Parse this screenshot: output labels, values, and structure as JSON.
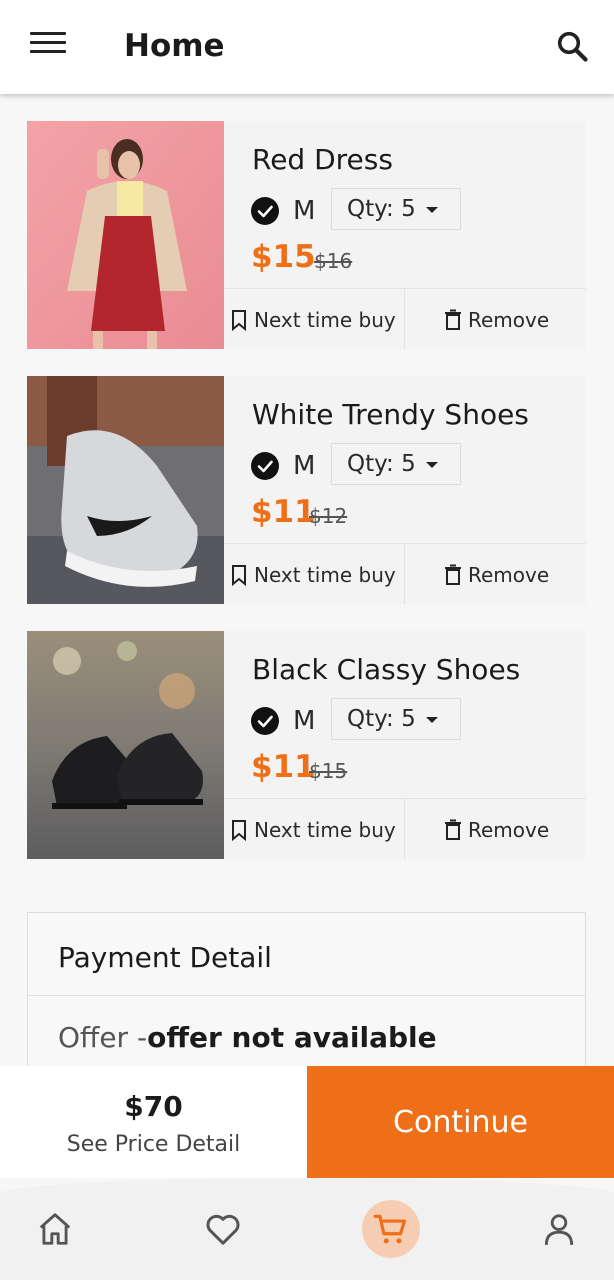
{
  "app_bar": {
    "title": "Home",
    "menu_icon": "hamburger-menu-icon",
    "search_icon": "search-icon"
  },
  "colors": {
    "accent": "#ef6f18",
    "accent_light": "#f6cdb3",
    "background": "#f7f7f7"
  },
  "cart_items": [
    {
      "name": "Red Dress",
      "size": "M",
      "qty_label": "Qty: 5",
      "price": "$15",
      "old_price": "$16",
      "next_time_label": "Next time buy",
      "remove_label": "Remove"
    },
    {
      "name": "White Trendy Shoes",
      "size": "M",
      "qty_label": "Qty: 5",
      "price": "$11",
      "old_price": "$12",
      "next_time_label": "Next time buy",
      "remove_label": "Remove"
    },
    {
      "name": "Black Classy Shoes",
      "size": "M",
      "qty_label": "Qty: 5",
      "price": "$11",
      "old_price": "$15",
      "next_time_label": "Next time buy",
      "remove_label": "Remove"
    }
  ],
  "payment": {
    "title": "Payment Detail",
    "offer_label": "Offer -",
    "offer_value": "offer not available"
  },
  "checkout": {
    "total": "$70",
    "see_detail": "See Price Detail",
    "continue_label": "Continue"
  },
  "bottom_nav": {
    "items": [
      {
        "icon": "home-icon",
        "active": false
      },
      {
        "icon": "heart-icon",
        "active": false
      },
      {
        "icon": "cart-icon",
        "active": true
      },
      {
        "icon": "profile-icon",
        "active": false
      }
    ]
  }
}
